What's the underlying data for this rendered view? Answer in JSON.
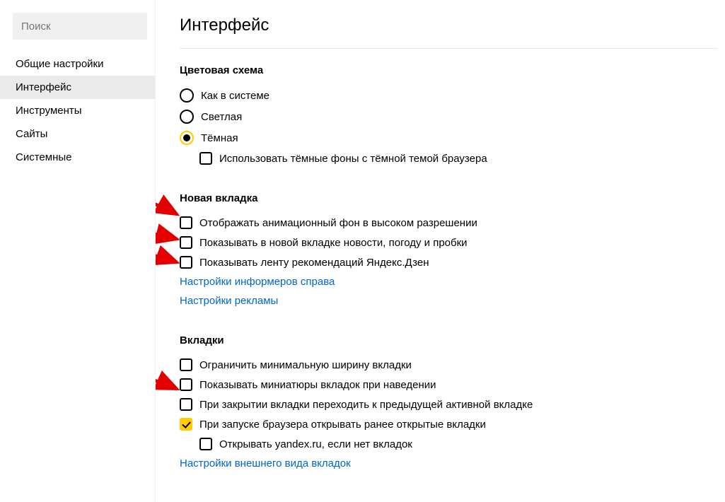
{
  "sidebar": {
    "search_placeholder": "Поиск",
    "items": [
      {
        "label": "Общие настройки",
        "active": false
      },
      {
        "label": "Интерфейс",
        "active": true
      },
      {
        "label": "Инструменты",
        "active": false
      },
      {
        "label": "Сайты",
        "active": false
      },
      {
        "label": "Системные",
        "active": false
      }
    ]
  },
  "page": {
    "title": "Интерфейс"
  },
  "sections": {
    "color_scheme": {
      "title": "Цветовая схема",
      "options": [
        {
          "label": "Как в системе",
          "selected": false
        },
        {
          "label": "Светлая",
          "selected": false
        },
        {
          "label": "Тёмная",
          "selected": true
        }
      ],
      "dark_bg_checkbox": {
        "label": "Использовать тёмные фоны с тёмной темой браузера",
        "checked": false
      }
    },
    "new_tab": {
      "title": "Новая вкладка",
      "checks": [
        {
          "label": "Отображать анимационный фон в высоком разрешении",
          "checked": false
        },
        {
          "label": "Показывать в новой вкладке новости, погоду и пробки",
          "checked": false
        },
        {
          "label": "Показывать ленту рекомендаций Яндекс.Дзен",
          "checked": false
        }
      ],
      "links": [
        "Настройки информеров справа",
        "Настройки рекламы"
      ]
    },
    "tabs": {
      "title": "Вкладки",
      "checks": [
        {
          "label": "Ограничить минимальную ширину вкладки",
          "checked": false
        },
        {
          "label": "Показывать миниатюры вкладок при наведении",
          "checked": false
        },
        {
          "label": "При закрытии вкладки переходить к предыдущей активной вкладке",
          "checked": false
        },
        {
          "label": "При запуске браузера открывать ранее открытые вкладки",
          "checked": true
        }
      ],
      "sub_check": {
        "label": "Открывать yandex.ru, если нет вкладок",
        "checked": false
      },
      "link": "Настройки внешнего вида вкладок"
    }
  }
}
